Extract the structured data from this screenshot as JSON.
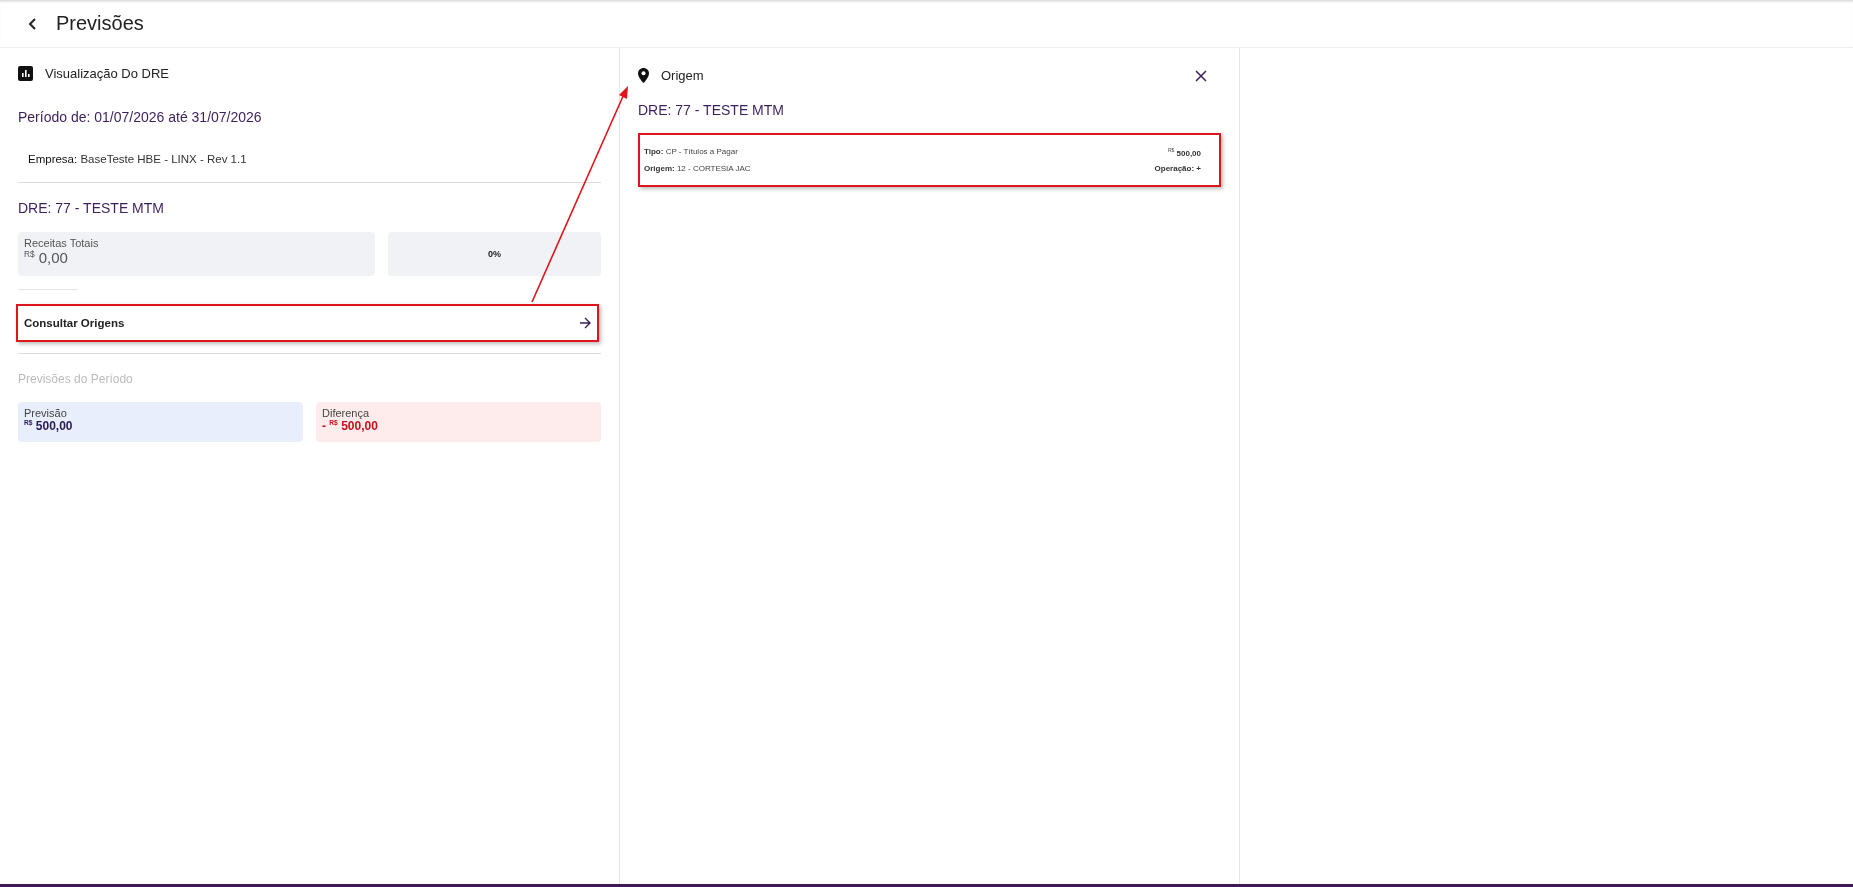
{
  "header": {
    "title": "Previsões"
  },
  "left_panel": {
    "title": "Visualização Do DRE",
    "period": "Período de: 01/07/2026 até 31/07/2026",
    "company_label": "Empresa:",
    "company_value": "BaseTeste HBE - LINX - Rev 1.1",
    "dre": "DRE: 77 - TESTE MTM",
    "summary": [
      {
        "kind": "money",
        "label": "Receitas Totais",
        "currency": "R$",
        "value": "0,00"
      },
      {
        "kind": "percent",
        "value": "0%"
      }
    ],
    "origins_link": {
      "label": "Consultar Origens",
      "highlighted": true
    },
    "forecast_title": "Previsões do Período",
    "forecast": [
      {
        "kind": "forecast",
        "label": "Previsão",
        "currency": "R$",
        "value": "500,00"
      },
      {
        "kind": "difference",
        "label": "Diferença",
        "sign": "-",
        "currency": "R$",
        "value": "500,00"
      }
    ]
  },
  "origin_panel": {
    "title": "Origem",
    "dre": "DRE: 77 - TESTE MTM",
    "items": [
      {
        "type_label": "Tipo:",
        "type_value": "CP - Títulos a Pagar",
        "origin_label": "Origem:",
        "origin_value": "12 - CORTESIA JAC",
        "currency": "R$",
        "amount": "500,00",
        "operation_label": "Operação:",
        "operation_value": "+",
        "highlighted": true
      }
    ]
  }
}
